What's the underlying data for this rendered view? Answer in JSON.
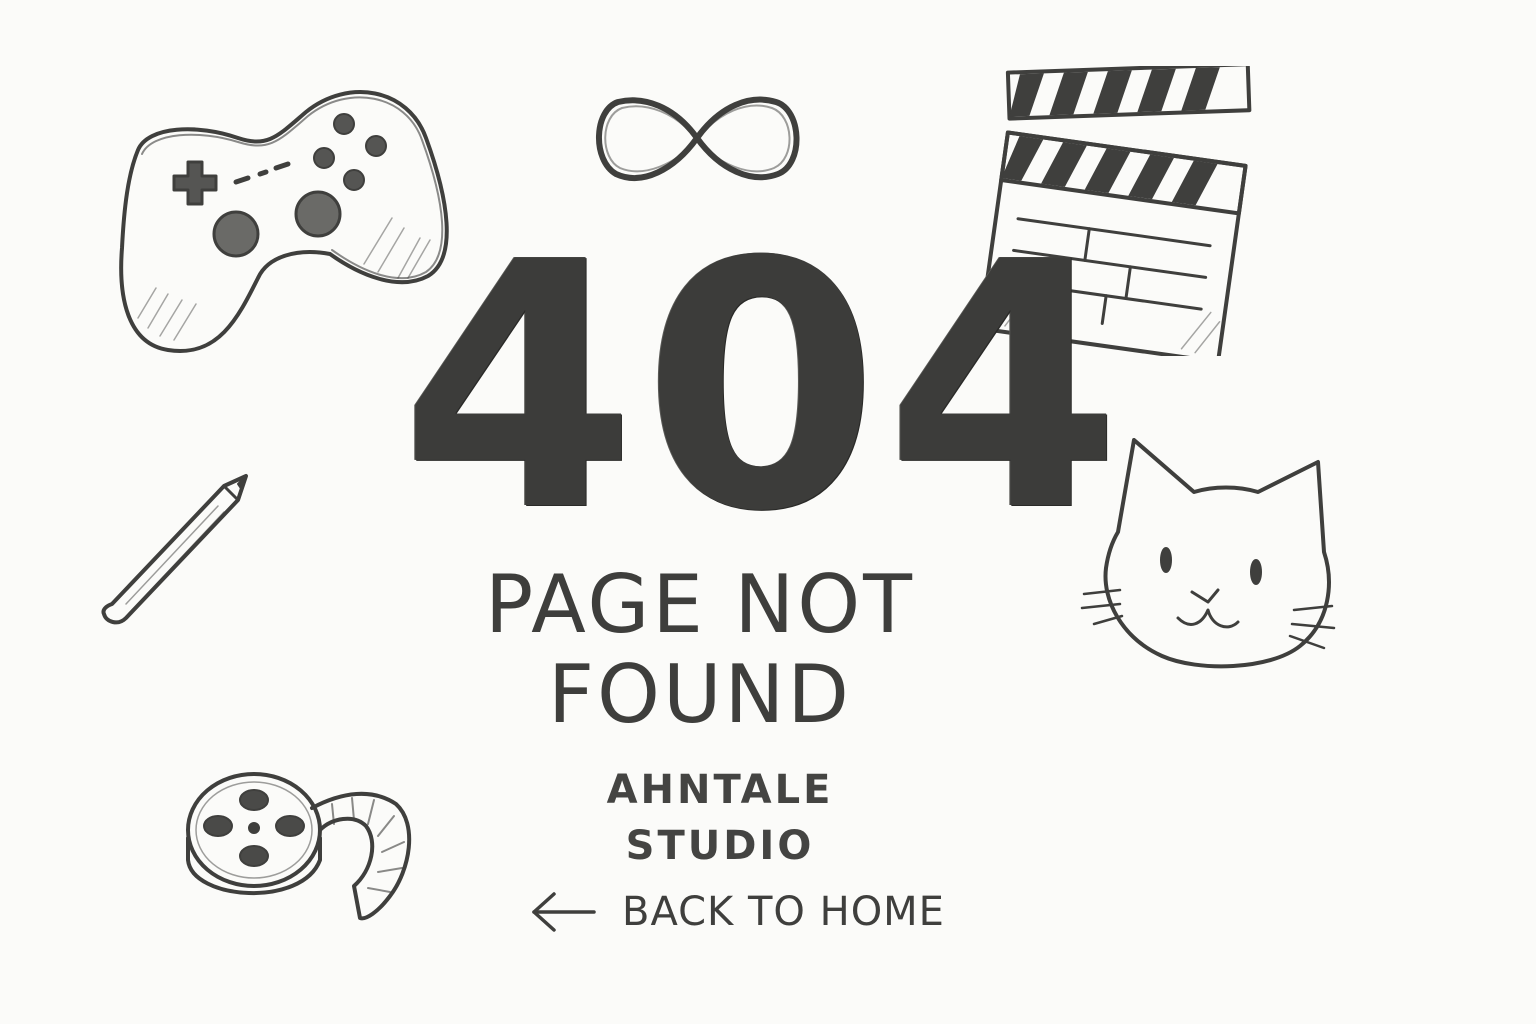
{
  "error": {
    "code": "404",
    "message": "PAGE NOT FOUND"
  },
  "footer": {
    "studio_name": "AHNTALE STUDIO",
    "back_label": "BACK TO HOME"
  },
  "icons": [
    "gamepad-icon",
    "infinity-icon",
    "clapperboard-icon",
    "pencil-icon",
    "cat-face-icon",
    "film-reel-icon",
    "arrow-left-icon"
  ],
  "colors": {
    "background": "#fbfbf9",
    "ink": "#3f3f3d"
  }
}
